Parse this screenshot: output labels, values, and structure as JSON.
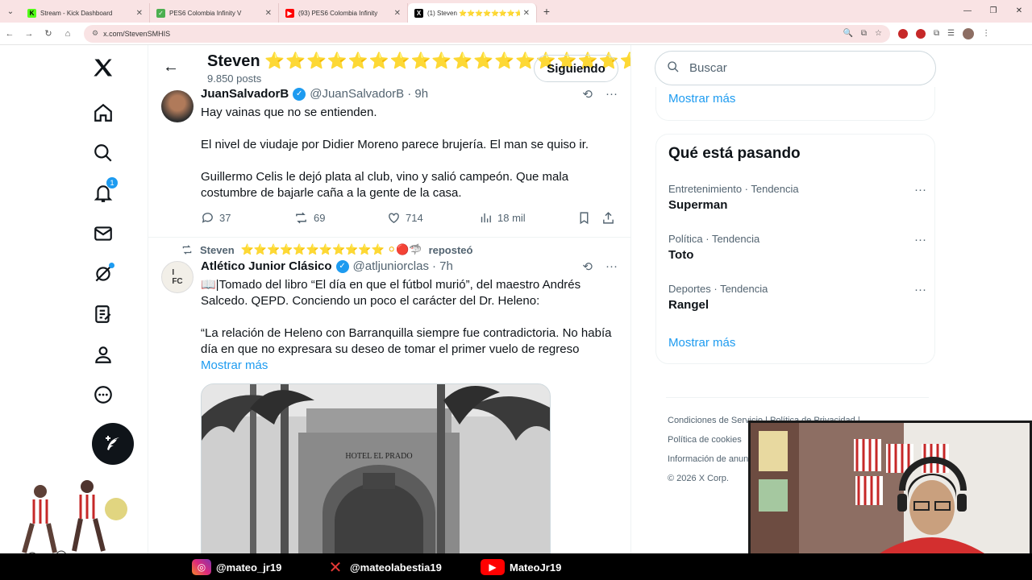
{
  "browser": {
    "tabs": [
      {
        "title": "Stream - Kick Dashboard",
        "favicon": "kick-icon",
        "color": "#53fc18"
      },
      {
        "title": "PES6 Colombia Infinity V",
        "favicon": "pes-icon",
        "color": "#4caf50"
      },
      {
        "title": "(93) PES6 Colombia Infinity",
        "favicon": "youtube-icon",
        "color": "#ff0000"
      },
      {
        "title": "(1) Steven ⭐⭐⭐⭐⭐⭐⭐⭐⭐",
        "favicon": "x-icon",
        "color": "#000000"
      }
    ],
    "url": "x.com/StevenSMHIS"
  },
  "nav": {
    "notifications_badge": "1"
  },
  "profile": {
    "name": "Steven",
    "stars": "⭐⭐⭐⭐⭐⭐⭐⭐⭐⭐⭐⭐⭐⭐⭐⭐⭐⭐⭐⭐⭐⭐⭐⭐⭐⭐⭐⭐⭐⭐ ...",
    "post_count": "9.850 posts",
    "follow_label": "Siguiendo"
  },
  "tweets": [
    {
      "name": "JuanSalvadorB",
      "handle": "@JuanSalvadorB",
      "time": "· 9h",
      "paragraphs": [
        "Hay vainas que no se entienden.",
        "El nivel de viudaje  por Didier Moreno parece brujería.  El man se quiso ir.",
        "Guillermo Celis le dejó plata al club, vino y salió campeón. Que mala costumbre de bajarle caña a la gente de la casa."
      ],
      "replies": "37",
      "reposts": "69",
      "likes": "714",
      "views": "18 mil"
    },
    {
      "repost_by": "Steven",
      "repost_label": "reposteó",
      "name": "Atlético Junior Clásico",
      "handle": "@atljuniorclas",
      "time": "· 7h",
      "line1": "📖|Tomado del libro “El día en que el fútbol murió”, del maestro Andrés Salcedo. QEPD. Conciendo un poco el carácter del Dr. Heleno:",
      "line2": "“La relación de Heleno con Barranquilla siempre fue contradictoria. No había día en que no expresara su deseo de tomar el primer vuelo de regreso",
      "more": "Mostrar más",
      "image_text": "HOTEL EL PRADO"
    }
  ],
  "right": {
    "search_placeholder": "Buscar",
    "show_more_1": "Mostrar más",
    "trends_title": "Qué está pasando",
    "trends": [
      {
        "category": "Entretenimiento · Tendencia",
        "name": "Superman"
      },
      {
        "category": "Política · Tendencia",
        "name": "Toto"
      },
      {
        "category": "Deportes · Tendencia",
        "name": "Rangel"
      }
    ],
    "show_more_2": "Mostrar más",
    "footer": {
      "terms": "Condiciones de Servicio",
      "privacy": "Política de Privacidad",
      "cookies": "Política de cookies",
      "ads": "Información de anun",
      "copyright": "© 2026 X Corp."
    }
  },
  "overlay": {
    "instagram": "@mateo_jr19",
    "x": "@mateolabestia19",
    "youtube": "MateoJr19"
  }
}
